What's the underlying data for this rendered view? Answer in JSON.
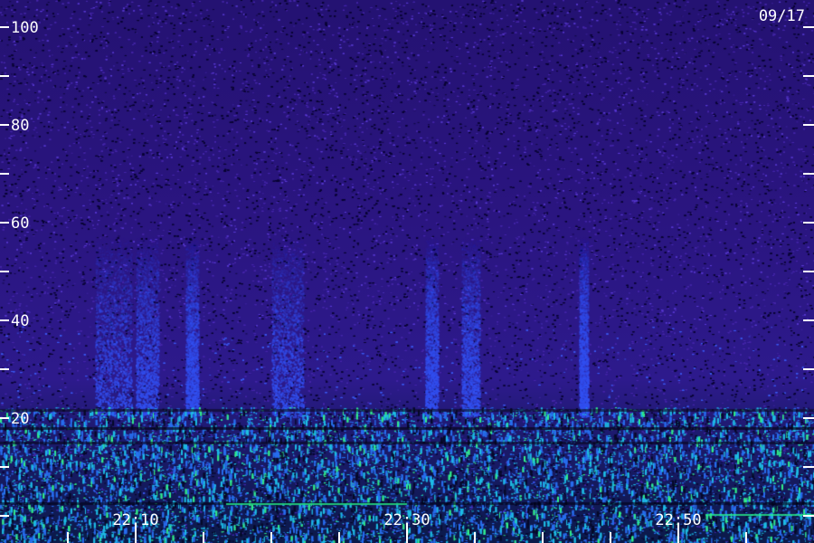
{
  "chart_data": {
    "type": "heatmap",
    "date_label": "09/17",
    "y_ticks": [
      20,
      40,
      60,
      80,
      100
    ],
    "ylim": [
      0,
      100
    ],
    "x_ticks": [
      "22:10",
      "22:30",
      "22:50"
    ],
    "colors": {
      "background": "#2a1580",
      "mid": "#2846d8",
      "high": "#20b4e0",
      "peak": "#30e890",
      "ticks": "#ffffff"
    }
  }
}
